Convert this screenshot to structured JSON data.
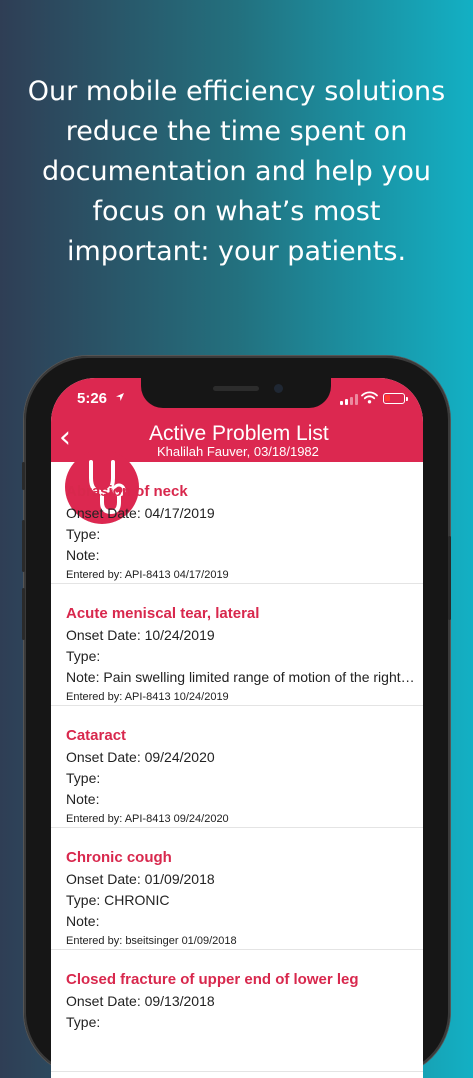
{
  "headline": {
    "lines": [
      "Our mobile efficiency solutions",
      "reduce the time spent on",
      "documentation and help you",
      "focus on what’s most",
      "important: your patients."
    ]
  },
  "status_bar": {
    "time": "5:26",
    "battery_color": "#ff3b30"
  },
  "nav": {
    "back_icon": "chevron-left-icon",
    "logo_icon": "stethoscope-icon",
    "title": "Active Problem List",
    "subtitle": "Khalilah Fauver, 03/18/1982"
  },
  "colors": {
    "accent": "#dc2850",
    "title_red": "#d8284d"
  },
  "problems": [
    {
      "title": "Abrasion of neck",
      "onset": "Onset Date: 04/17/2019",
      "type": "Type:",
      "note": "Note:",
      "entered": "Entered by: API-8413 04/17/2019"
    },
    {
      "title": "Acute meniscal tear, lateral",
      "onset": "Onset Date: 10/24/2019",
      "type": "Type:",
      "note": "Note: Pain swelling limited range of motion of the right…",
      "entered": "Entered by: API-8413 10/24/2019"
    },
    {
      "title": "Cataract",
      "onset": "Onset Date: 09/24/2020",
      "type": "Type:",
      "note": "Note:",
      "entered": "Entered by: API-8413 09/24/2020"
    },
    {
      "title": "Chronic cough",
      "onset": "Onset Date: 01/09/2018",
      "type": "Type: CHRONIC",
      "note": "Note:",
      "entered": "Entered by: bseitsinger 01/09/2018"
    },
    {
      "title": "Closed fracture of upper end of lower leg",
      "onset": "Onset Date: 09/13/2018",
      "type": "Type:",
      "note": "",
      "entered": ""
    }
  ]
}
